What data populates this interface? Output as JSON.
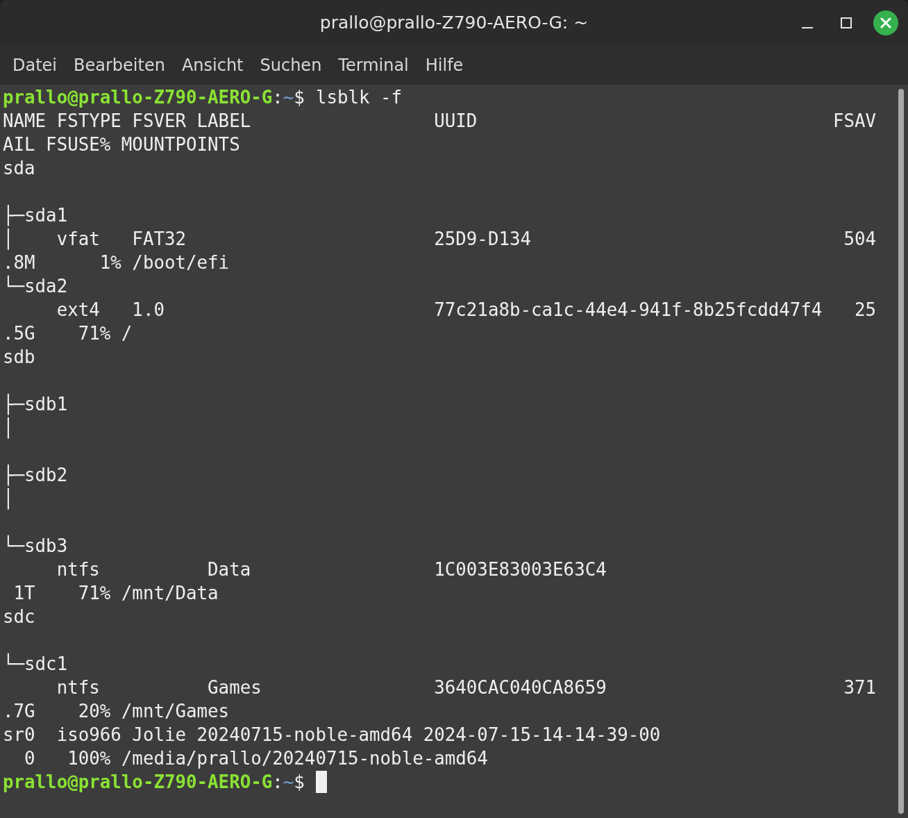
{
  "window": {
    "title": "prallo@prallo-Z790-AERO-G: ~"
  },
  "menu": [
    "Datei",
    "Bearbeiten",
    "Ansicht",
    "Suchen",
    "Terminal",
    "Hilfe"
  ],
  "terminal": {
    "lines": [
      {
        "kind": "prompt",
        "user": "prallo@prallo-Z790-AERO-G",
        "sep": ":",
        "path": "~",
        "symbol": "$",
        "command": "lsblk -f"
      },
      {
        "kind": "output",
        "text": "NAME FSTYPE FSVER LABEL                 UUID                                 FSAV"
      },
      {
        "kind": "output",
        "text": "AIL FSUSE% MOUNTPOINTS"
      },
      {
        "kind": "output",
        "text": "sda"
      },
      {
        "kind": "blank"
      },
      {
        "kind": "output",
        "text": "├─sda1"
      },
      {
        "kind": "output",
        "text": "│    vfat   FAT32                       25D9-D134                             504"
      },
      {
        "kind": "output",
        "text": ".8M      1% /boot/efi"
      },
      {
        "kind": "output",
        "text": "└─sda2"
      },
      {
        "kind": "output",
        "text": "     ext4   1.0                         77c21a8b-ca1c-44e4-941f-8b25fcdd47f4   25"
      },
      {
        "kind": "output",
        "text": ".5G    71% /"
      },
      {
        "kind": "output",
        "text": "sdb"
      },
      {
        "kind": "blank"
      },
      {
        "kind": "output",
        "text": "├─sdb1"
      },
      {
        "kind": "output",
        "text": "│"
      },
      {
        "kind": "blank"
      },
      {
        "kind": "output",
        "text": "├─sdb2"
      },
      {
        "kind": "output",
        "text": "│"
      },
      {
        "kind": "blank"
      },
      {
        "kind": "output",
        "text": "└─sdb3"
      },
      {
        "kind": "output",
        "text": "     ntfs          Data                 1C003E83003E63C4"
      },
      {
        "kind": "output",
        "text": " 1T    71% /mnt/Data"
      },
      {
        "kind": "output",
        "text": "sdc"
      },
      {
        "kind": "blank"
      },
      {
        "kind": "output",
        "text": "└─sdc1"
      },
      {
        "kind": "output",
        "text": "     ntfs          Games                3640CAC040CA8659                      371"
      },
      {
        "kind": "output",
        "text": ".7G    20% /mnt/Games"
      },
      {
        "kind": "output",
        "text": "sr0  iso966 Jolie 20240715-noble-amd64 2024-07-15-14-14-39-00"
      },
      {
        "kind": "output",
        "text": "  0   100% /media/prallo/20240715-noble-amd64"
      },
      {
        "kind": "prompt",
        "user": "prallo@prallo-Z790-AERO-G",
        "sep": ":",
        "path": "~",
        "symbol": "$",
        "cursor": true
      }
    ]
  }
}
